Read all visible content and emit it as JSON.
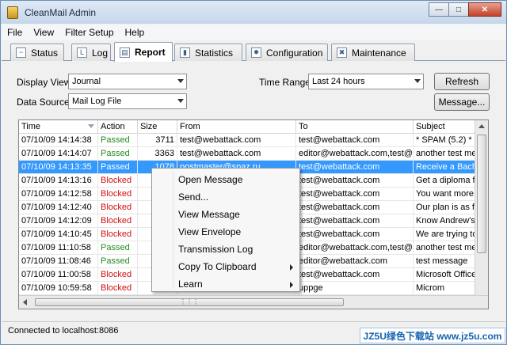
{
  "window": {
    "title": "CleanMail Admin"
  },
  "menu": [
    "File",
    "View",
    "Filter Setup",
    "Help"
  ],
  "tabs": [
    {
      "label": "Status",
      "icon": "chart-icon"
    },
    {
      "label": "Log",
      "icon": "log-icon"
    },
    {
      "label": "Report",
      "icon": "report-icon",
      "active": true
    },
    {
      "label": "Statistics",
      "icon": "bar-chart-icon"
    },
    {
      "label": "Configuration",
      "icon": "wrench-icon"
    },
    {
      "label": "Maintenance",
      "icon": "tools-icon"
    }
  ],
  "filters": {
    "display_view_label": "Display View",
    "display_view_value": "Journal",
    "data_source_label": "Data Source",
    "data_source_value": "Mail Log File",
    "time_range_label": "Time Range",
    "time_range_value": "Last 24 hours",
    "refresh_label": "Refresh",
    "message_label": "Message..."
  },
  "table": {
    "columns": [
      "Time",
      "Action",
      "Size",
      "From",
      "To",
      "Subject"
    ],
    "rows": [
      {
        "time": "07/10/09 14:14:38",
        "action": "Passed",
        "size": "3711",
        "from": "test@webattack.com",
        "to": "test@webattack.com",
        "subject": "* SPAM (5.2) * I"
      },
      {
        "time": "07/10/09 14:14:07",
        "action": "Passed",
        "size": "3363",
        "from": "test@webattack.com",
        "to": "editor@webattack.com,test@w",
        "subject": "another test me"
      },
      {
        "time": "07/10/09 14:13:35",
        "action": "Passed",
        "size": "1078",
        "from": "postmaster@spaz.ru",
        "to": "test@webattack.com",
        "subject": "Receive a Bache",
        "selected": true
      },
      {
        "time": "07/10/09 14:13:16",
        "action": "Blocked",
        "size": "",
        "from": "",
        "to": "test@webattack.com",
        "subject": "Get a diploma fo"
      },
      {
        "time": "07/10/09 14:12:58",
        "action": "Blocked",
        "size": "",
        "from": "",
        "to": "test@webattack.com",
        "subject": "You want more d"
      },
      {
        "time": "07/10/09 14:12:40",
        "action": "Blocked",
        "size": "",
        "from": "",
        "to": "test@webattack.com",
        "subject": "Our plan is as fo"
      },
      {
        "time": "07/10/09 14:12:09",
        "action": "Blocked",
        "size": "",
        "from": "",
        "to": "test@webattack.com",
        "subject": "Know Andrew's"
      },
      {
        "time": "07/10/09 14:10:45",
        "action": "Blocked",
        "size": "",
        "from": "",
        "to": "test@webattack.com",
        "subject": "We are trying to"
      },
      {
        "time": "07/10/09 11:10:58",
        "action": "Passed",
        "size": "",
        "from": "",
        "to": "editor@webattack.com,test@w",
        "subject": "another test me"
      },
      {
        "time": "07/10/09 11:08:46",
        "action": "Passed",
        "size": "",
        "from": "",
        "to": "editor@webattack.com",
        "subject": "test message"
      },
      {
        "time": "07/10/09 11:00:58",
        "action": "Blocked",
        "size": "",
        "from": "",
        "to": "test@webattack.com",
        "subject": "Microsoft Office"
      },
      {
        "time": "07/10/09 10:59:58",
        "action": "Blocked",
        "size": "",
        "from": "",
        "to": "uppge",
        "subject": "Microm"
      }
    ]
  },
  "context_menu": [
    {
      "label": "Open Message"
    },
    {
      "label": "Send..."
    },
    {
      "label": "View Message"
    },
    {
      "label": "View Envelope"
    },
    {
      "label": "Transmission Log"
    },
    {
      "label": "Copy To Clipboard",
      "submenu": true
    },
    {
      "label": "Learn",
      "submenu": true
    }
  ],
  "status": {
    "text": "Connected to localhost:8086"
  },
  "watermark": {
    "text": "JZ5U绿色下载站 www.jz5u.com"
  },
  "colors": {
    "passed": "#228b22",
    "blocked": "#d01010",
    "selection": "#3399ff"
  }
}
